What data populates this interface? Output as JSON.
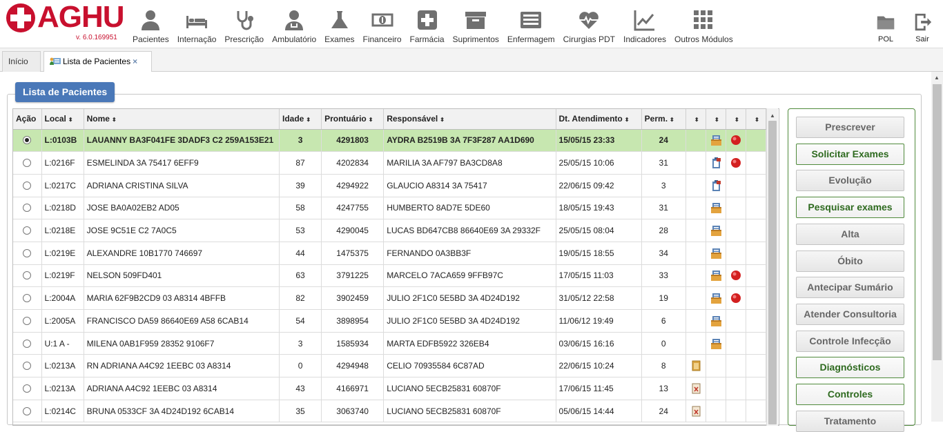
{
  "app": {
    "brand": "AGHU",
    "version": "v. 6.0.169951"
  },
  "modules": [
    {
      "id": "pacientes",
      "label": "Pacientes",
      "icon": "person-icon"
    },
    {
      "id": "internacao",
      "label": "Internação",
      "icon": "bed-icon"
    },
    {
      "id": "prescricao",
      "label": "Prescrição",
      "icon": "stethoscope-icon"
    },
    {
      "id": "ambulatorio",
      "label": "Ambulatório",
      "icon": "doctor-icon"
    },
    {
      "id": "exames",
      "label": "Exames",
      "icon": "flask-icon"
    },
    {
      "id": "financeiro",
      "label": "Financeiro",
      "icon": "money-icon"
    },
    {
      "id": "farmacia",
      "label": "Farmácia",
      "icon": "plus-box-icon"
    },
    {
      "id": "suprimentos",
      "label": "Suprimentos",
      "icon": "archive-icon"
    },
    {
      "id": "enfermagem",
      "label": "Enfermagem",
      "icon": "list-icon"
    },
    {
      "id": "cirurgias",
      "label": "Cirurgias PDT",
      "icon": "heartbeat-icon"
    },
    {
      "id": "indicadores",
      "label": "Indicadores",
      "icon": "line-chart-icon"
    },
    {
      "id": "outros",
      "label": "Outros Módulos",
      "icon": "grid-icon"
    }
  ],
  "right_modules": [
    {
      "id": "pol",
      "label": "POL",
      "icon": "folder-icon"
    },
    {
      "id": "sair",
      "label": "Sair",
      "icon": "exit-icon"
    }
  ],
  "tabs": [
    {
      "label": "Início",
      "active": false
    },
    {
      "label": "Lista de Pacientes",
      "active": true,
      "icon": "patient-list-icon",
      "close": "×"
    }
  ],
  "panel": {
    "title": "Lista de Pacientes"
  },
  "table": {
    "sort_glyph": "⬍",
    "columns": [
      "Ação",
      "Local",
      "Nome",
      "Idade",
      "Prontuário",
      "Responsável",
      "Dt. Atendimento",
      "Perm.",
      "",
      "",
      "",
      ""
    ],
    "rows": [
      {
        "local": "L:0103B",
        "nome": "LAUANNY BA3F041FE 3DADF3 C2 259A153E21",
        "idade": "3",
        "prontuario": "4291803",
        "responsavel": "AYDRA B2519B 3A 7F3F287 AA1D690",
        "dt": "15/05/15 23:33",
        "perm": "24",
        "i1": "",
        "i2": "records-icon",
        "i3": "alert-red-icon",
        "selected": true
      },
      {
        "local": "L:0216F",
        "nome": "ESMELINDA 3A 75417 6EFF9",
        "idade": "87",
        "prontuario": "4202834",
        "responsavel": "MARILIA 3A AF797 BA3CD8A8",
        "dt": "25/05/15 10:06",
        "perm": "31",
        "i1": "",
        "i2": "clipboard-icon",
        "i3": "alert-red-icon",
        "selected": false
      },
      {
        "local": "L:0217C",
        "nome": "ADRIANA CRISTINA SILVA",
        "idade": "39",
        "prontuario": "4294922",
        "responsavel": "GLAUCIO A8314 3A 75417",
        "dt": "22/06/15 09:42",
        "perm": "3",
        "i1": "",
        "i2": "clipboard-icon",
        "i3": "",
        "selected": false
      },
      {
        "local": "L:0218D",
        "nome": "JOSE BA0A02EB2 AD05",
        "idade": "58",
        "prontuario": "4247755",
        "responsavel": "HUMBERTO 8AD7E 5DE60",
        "dt": "18/05/15 19:43",
        "perm": "31",
        "i1": "",
        "i2": "records-icon",
        "i3": "",
        "selected": false
      },
      {
        "local": "L:0218E",
        "nome": "JOSE 9C51E C2 7A0C5",
        "idade": "53",
        "prontuario": "4290045",
        "responsavel": "LUCAS BD647CB8 86640E69 3A 29332F",
        "dt": "25/05/15 08:04",
        "perm": "28",
        "i1": "",
        "i2": "records-icon",
        "i3": "",
        "selected": false
      },
      {
        "local": "L:0219E",
        "nome": "ALEXANDRE 10B1770 746697",
        "idade": "44",
        "prontuario": "1475375",
        "responsavel": "FERNANDO 0A3BB3F",
        "dt": "19/05/15 18:55",
        "perm": "34",
        "i1": "",
        "i2": "records-icon",
        "i3": "",
        "selected": false
      },
      {
        "local": "L:0219F",
        "nome": "NELSON 509FD401",
        "idade": "63",
        "prontuario": "3791225",
        "responsavel": "MARCELO 7ACA659 9FFB97C",
        "dt": "17/05/15 11:03",
        "perm": "33",
        "i1": "",
        "i2": "records-icon",
        "i3": "alert-red-icon",
        "selected": false
      },
      {
        "local": "L:2004A",
        "nome": "MARIA 62F9B2CD9 03 A8314 4BFFB",
        "idade": "82",
        "prontuario": "3902459",
        "responsavel": "JULIO 2F1C0 5E5BD 3A 4D24D192",
        "dt": "31/05/12 22:58",
        "perm": "19",
        "i1": "",
        "i2": "records-icon",
        "i3": "alert-red-icon",
        "selected": false
      },
      {
        "local": "L:2005A",
        "nome": "FRANCISCO DA59 86640E69 A58 6CAB14",
        "idade": "54",
        "prontuario": "3898954",
        "responsavel": "JULIO 2F1C0 5E5BD 3A 4D24D192",
        "dt": "11/06/12 19:49",
        "perm": "6",
        "i1": "",
        "i2": "records-icon",
        "i3": "",
        "selected": false
      },
      {
        "local": "U:1 A -",
        "nome": "MILENA 0AB1F959 28352 9106F7",
        "idade": "3",
        "prontuario": "1585934",
        "responsavel": "MARTA EDFB5922 326EB4",
        "dt": "03/06/15 16:16",
        "perm": "0",
        "i1": "",
        "i2": "records-icon",
        "i3": "",
        "selected": false
      },
      {
        "local": "L:0213A",
        "nome": "RN ADRIANA A4C92 1EEBC 03 A8314",
        "idade": "0",
        "prontuario": "4294948",
        "responsavel": "CELIO 70935584 6C87AD",
        "dt": "22/06/15 10:24",
        "perm": "8",
        "i1": "document-icon",
        "i2": "",
        "i3": "",
        "selected": false
      },
      {
        "local": "L:0213A",
        "nome": "ADRIANA A4C92 1EEBC 03 A8314",
        "idade": "43",
        "prontuario": "4166971",
        "responsavel": "LUCIANO 5ECB25831 60870F",
        "dt": "17/06/15 11:45",
        "perm": "13",
        "i1": "document-x-icon",
        "i2": "",
        "i3": "",
        "selected": false
      },
      {
        "local": "L:0214C",
        "nome": "BRUNA 0533CF 3A 4D24D192 6CAB14",
        "idade": "35",
        "prontuario": "3063740",
        "responsavel": "LUCIANO 5ECB25831 60870F",
        "dt": "05/06/15 14:44",
        "perm": "24",
        "i1": "document-x-icon",
        "i2": "",
        "i3": "",
        "selected": false
      }
    ]
  },
  "actions": [
    {
      "label": "Prescrever",
      "enabled": false
    },
    {
      "label": "Solicitar Exames",
      "enabled": true
    },
    {
      "label": "Evolução",
      "enabled": false
    },
    {
      "label": "Pesquisar exames",
      "enabled": true
    },
    {
      "label": "Alta",
      "enabled": false
    },
    {
      "label": "Óbito",
      "enabled": false
    },
    {
      "label": "Antecipar Sumário",
      "enabled": false
    },
    {
      "label": "Atender Consultoria",
      "enabled": false
    },
    {
      "label": "Controle Infecção",
      "enabled": false
    },
    {
      "label": "Diagnósticos",
      "enabled": true
    },
    {
      "label": "Controles",
      "enabled": true
    },
    {
      "label": "Tratamento",
      "enabled": false
    }
  ],
  "colors": {
    "brand": "#c8102e",
    "selected_row": "#c7e7b0",
    "legend": "#4a78b8",
    "action_border": "#4f8a3b"
  }
}
